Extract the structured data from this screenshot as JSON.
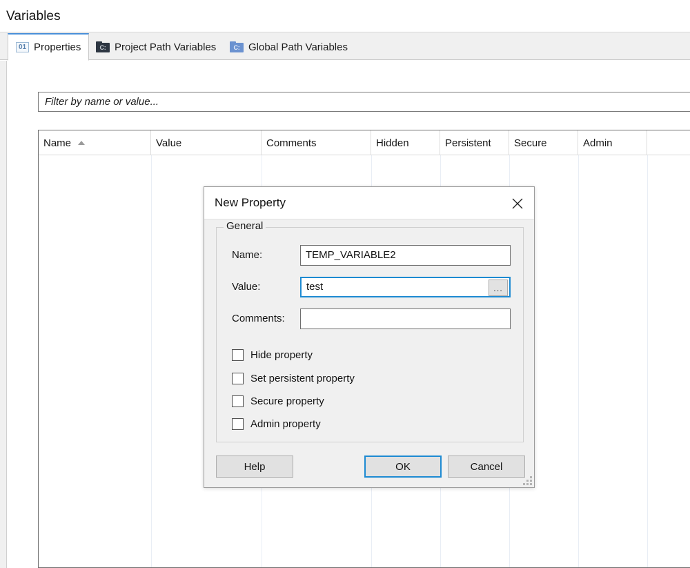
{
  "view": {
    "title": "Variables"
  },
  "tabs": [
    {
      "label": "Properties",
      "icon": "number-01-icon",
      "active": true
    },
    {
      "label": "Project Path Variables",
      "icon": "folder-dark-icon",
      "active": false
    },
    {
      "label": "Global Path Variables",
      "icon": "folder-blue-icon",
      "active": false
    }
  ],
  "filter": {
    "placeholder": "Filter by name or value...",
    "value": ""
  },
  "table": {
    "columns": [
      {
        "label": "Name",
        "sorted": "asc"
      },
      {
        "label": "Value",
        "sorted": ""
      },
      {
        "label": "Comments",
        "sorted": ""
      },
      {
        "label": "Hidden",
        "sorted": ""
      },
      {
        "label": "Persistent",
        "sorted": ""
      },
      {
        "label": "Secure",
        "sorted": ""
      },
      {
        "label": "Admin",
        "sorted": ""
      }
    ],
    "rows": []
  },
  "dialog": {
    "title": "New Property",
    "close_label": "✕",
    "group_legend": "General",
    "fields": [
      {
        "label": "Name:",
        "value": "TEMP_VARIABLE2",
        "focused": false,
        "has_browse": false
      },
      {
        "label": "Value:",
        "value": "test",
        "focused": true,
        "has_browse": true,
        "browse_label": "..."
      },
      {
        "label": "Comments:",
        "value": "",
        "focused": false,
        "has_browse": false
      }
    ],
    "checkboxes": [
      {
        "label": "Hide property",
        "checked": false
      },
      {
        "label": "Set persistent property",
        "checked": false
      },
      {
        "label": "Secure property",
        "checked": false
      },
      {
        "label": "Admin property",
        "checked": false
      }
    ],
    "buttons": {
      "help": "Help",
      "ok": "OK",
      "cancel": "Cancel"
    }
  },
  "colors": {
    "accent": "#1d8ad2",
    "tab_active_border": "#4a90d9",
    "panel_bg": "#f0f0f0",
    "folder_dark": "#2d3642",
    "folder_blue": "#6b92d0"
  }
}
